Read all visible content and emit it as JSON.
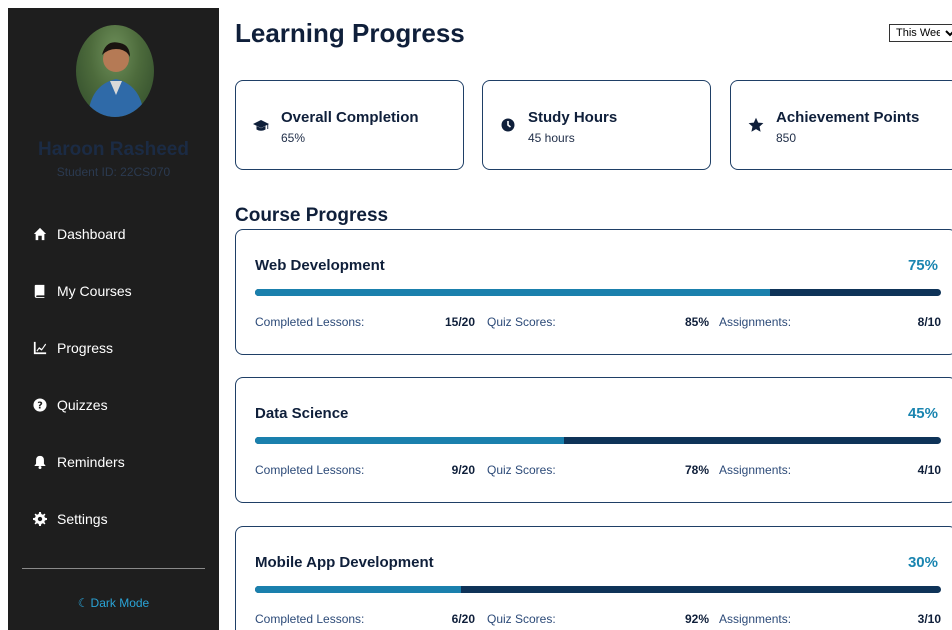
{
  "sidebar": {
    "user_name": "Haroon Rasheed",
    "user_id": "Student ID: 22CS070",
    "nav": [
      {
        "label": "Dashboard",
        "icon": "home-icon"
      },
      {
        "label": "My Courses",
        "icon": "book-icon"
      },
      {
        "label": "Progress",
        "icon": "chart-line-icon"
      },
      {
        "label": "Quizzes",
        "icon": "question-circle-icon"
      },
      {
        "label": "Reminders",
        "icon": "bell-icon"
      },
      {
        "label": "Settings",
        "icon": "gear-icon"
      }
    ],
    "dark_mode_label": "Dark Mode"
  },
  "main": {
    "title": "Learning Progress",
    "period_selected": "This Week",
    "stats": [
      {
        "label": "Overall Completion",
        "value": "65%",
        "icon": "graduation-cap-icon"
      },
      {
        "label": "Study Hours",
        "value": "45 hours",
        "icon": "clock-icon"
      },
      {
        "label": "Achievement Points",
        "value": "850",
        "icon": "star-icon"
      }
    ],
    "section_title": "Course Progress",
    "courses": [
      {
        "name": "Web Development",
        "percent": "75%",
        "progress": 0.75,
        "lessons_label": "Completed Lessons:",
        "lessons": "15/20",
        "quiz_label": "Quiz Scores:",
        "quiz": "85%",
        "assign_label": "Assignments:",
        "assign": "8/10"
      },
      {
        "name": "Data Science",
        "percent": "45%",
        "progress": 0.45,
        "lessons_label": "Completed Lessons:",
        "lessons": "9/20",
        "quiz_label": "Quiz Scores:",
        "quiz": "78%",
        "assign_label": "Assignments:",
        "assign": "4/10"
      },
      {
        "name": "Mobile App Development",
        "percent": "30%",
        "progress": 0.3,
        "lessons_label": "Completed Lessons:",
        "lessons": "6/20",
        "quiz_label": "Quiz Scores:",
        "quiz": "92%",
        "assign_label": "Assignments:",
        "assign": "3/10"
      }
    ]
  },
  "colors": {
    "sidebar_bg": "#1e1e1e",
    "accent": "#1a85b0",
    "progress_track": "#0e3358",
    "card_border": "#1f3f66",
    "heading": "#0f1f3a"
  }
}
